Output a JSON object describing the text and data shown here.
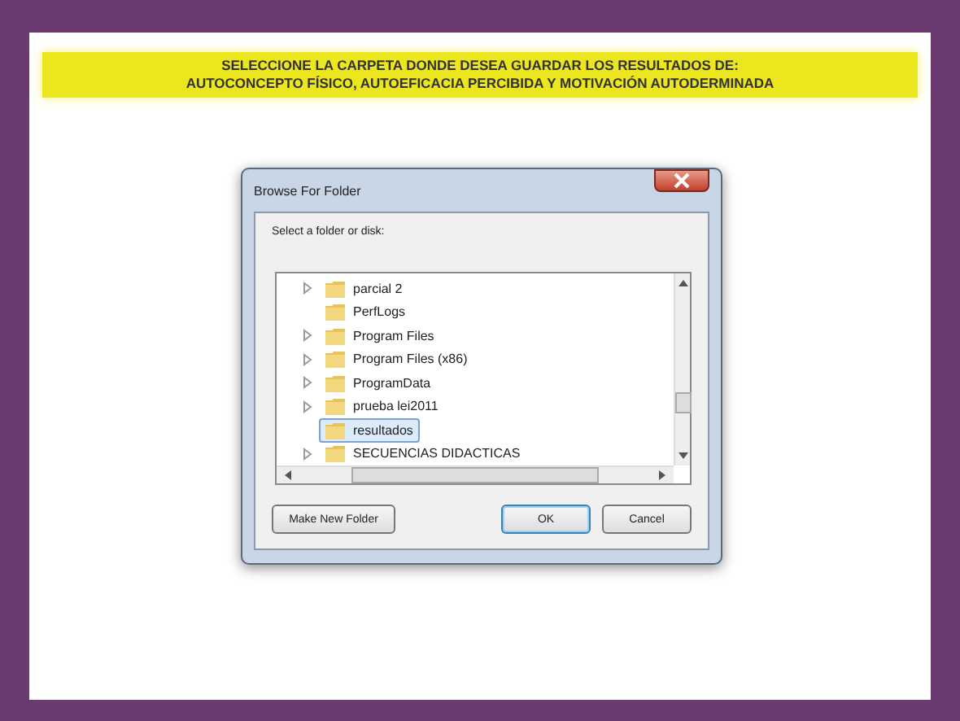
{
  "banner": {
    "lines": [
      "SELECCIONE LA CARPETA DONDE DESEA GUARDAR LOS RESULTADOS DE:",
      "AUTOCONCEPTO FÍSICO, AUTOEFICACIA PERCIBIDA Y MOTIVACIÓN AUTODERMINADA"
    ]
  },
  "dialog": {
    "title": "Browse For Folder",
    "prompt": "Select a folder or disk:",
    "tree": [
      {
        "label": "parcial 2",
        "expandable": true,
        "selected": false
      },
      {
        "label": "PerfLogs",
        "expandable": false,
        "selected": false
      },
      {
        "label": "Program Files",
        "expandable": true,
        "selected": false
      },
      {
        "label": "Program Files (x86)",
        "expandable": true,
        "selected": false
      },
      {
        "label": "ProgramData",
        "expandable": true,
        "selected": false
      },
      {
        "label": "prueba lei2011",
        "expandable": true,
        "selected": false
      },
      {
        "label": "resultados",
        "expandable": false,
        "selected": true
      },
      {
        "label": "SECUENCIAS DIDACTICAS",
        "expandable": true,
        "selected": false
      }
    ],
    "buttons": [
      {
        "label": "Make New Folder",
        "default": false
      },
      {
        "label": "OK",
        "default": true
      },
      {
        "label": "Cancel",
        "default": false
      }
    ]
  }
}
